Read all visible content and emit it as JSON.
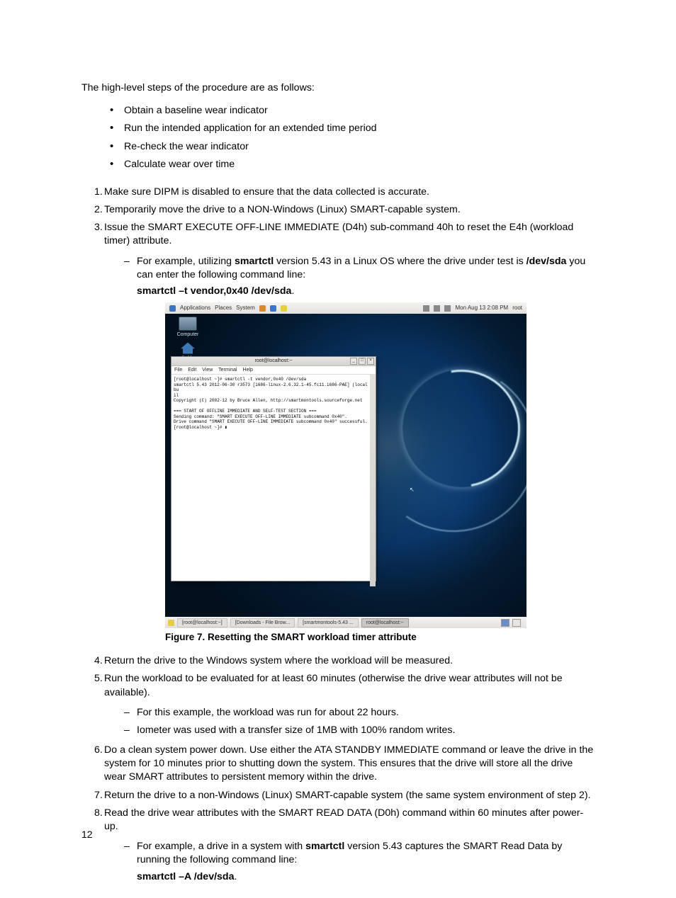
{
  "intro": "The high-level steps of the procedure are as follows:",
  "bullets": [
    "Obtain a baseline wear indicator",
    "Run the intended application for an extended time period",
    "Re-check the wear indicator",
    "Calculate wear over time"
  ],
  "step1": "Make sure DIPM is disabled to ensure that the data collected is accurate.",
  "step2": "Temporarily move the drive to a NON-Windows (Linux) SMART-capable system.",
  "step3": "Issue the SMART EXECUTE OFF-LINE IMMEDIATE (D4h) sub-command 40h to reset the E4h (workload timer) attribute.",
  "step3a_pre": "For example, utilizing ",
  "step3a_bold1": "smartctl",
  "step3a_mid": " version 5.43 in a Linux OS where the drive under test is ",
  "step3a_bold2": "/dev/sda",
  "step3a_post": " you can enter the following command line:",
  "step3_cmd": "smartctl –t vendor,0x40 /dev/sda",
  "step3_cmd_dot": ".",
  "gnome": {
    "menu1": "Applications",
    "menu2": "Places",
    "menu3": "System",
    "clock": "Mon Aug 13   2:08 PM",
    "user": "root",
    "icon_computer": "Computer",
    "icon_home": "root's Home",
    "term_title": "root@localhost:~",
    "term_menu": [
      "File",
      "Edit",
      "View",
      "Terminal",
      "Help"
    ],
    "term_text": "[root@localhost ~]# smartctl -t vendor,0x40 /dev/sda\nsmartctl 5.43 2012-06-30 r3573 [i686-linux-2.6.32.1-45.fc11.i686-PAE] (local bu\nil\nCopyright (C) 2002-12 by Bruce Allen, http://smartmontools.sourceforge.net\n\n=== START OF OFFLINE IMMEDIATE AND SELF-TEST SECTION ===\nSending command: \"SMART EXECUTE OFF-LINE IMMEDIATE subcommand 0x40\".\nDrive command \"SMART EXECUTE OFF-LINE IMMEDIATE subcommand 0x40\" successful.\n[root@localhost ~]# ▮",
    "task1": "[root@localhost:~]",
    "task2": "[Downloads - File Brow...",
    "task3": "[smartmontools-5.43 ...",
    "task4": "root@localhost:~"
  },
  "fig_caption": "Figure 7. Resetting the SMART workload timer attribute",
  "step4": "Return the drive to the Windows system where the workload will be measured.",
  "step5": "Run the workload to be evaluated for at least 60 minutes (otherwise the drive wear attributes will not be available).",
  "step5a": "For this example, the workload was run for about 22 hours.",
  "step5b": "Iometer was used with a transfer size of 1MB with 100% random writes.",
  "step6": "Do a clean system power down. Use either the ATA STANDBY IMMEDIATE command or leave the drive in the system for 10 minutes prior to shutting down the system. This ensures that the drive will store all the drive wear SMART attributes to persistent memory within the drive.",
  "step7": "Return the drive to a non-Windows (Linux) SMART-capable system (the same system environment of step 2).",
  "step8": "Read the drive wear attributes with the SMART READ DATA (D0h) command within 60 minutes after power-up.",
  "step8a_pre": "For example, a drive in a system with ",
  "step8a_bold": "smartctl",
  "step8a_post": " version 5.43 captures the SMART Read Data by running the following command line:",
  "step8_cmd": "smartctl –A /dev/sda",
  "step8_cmd_dot": ".",
  "page_number": "12"
}
